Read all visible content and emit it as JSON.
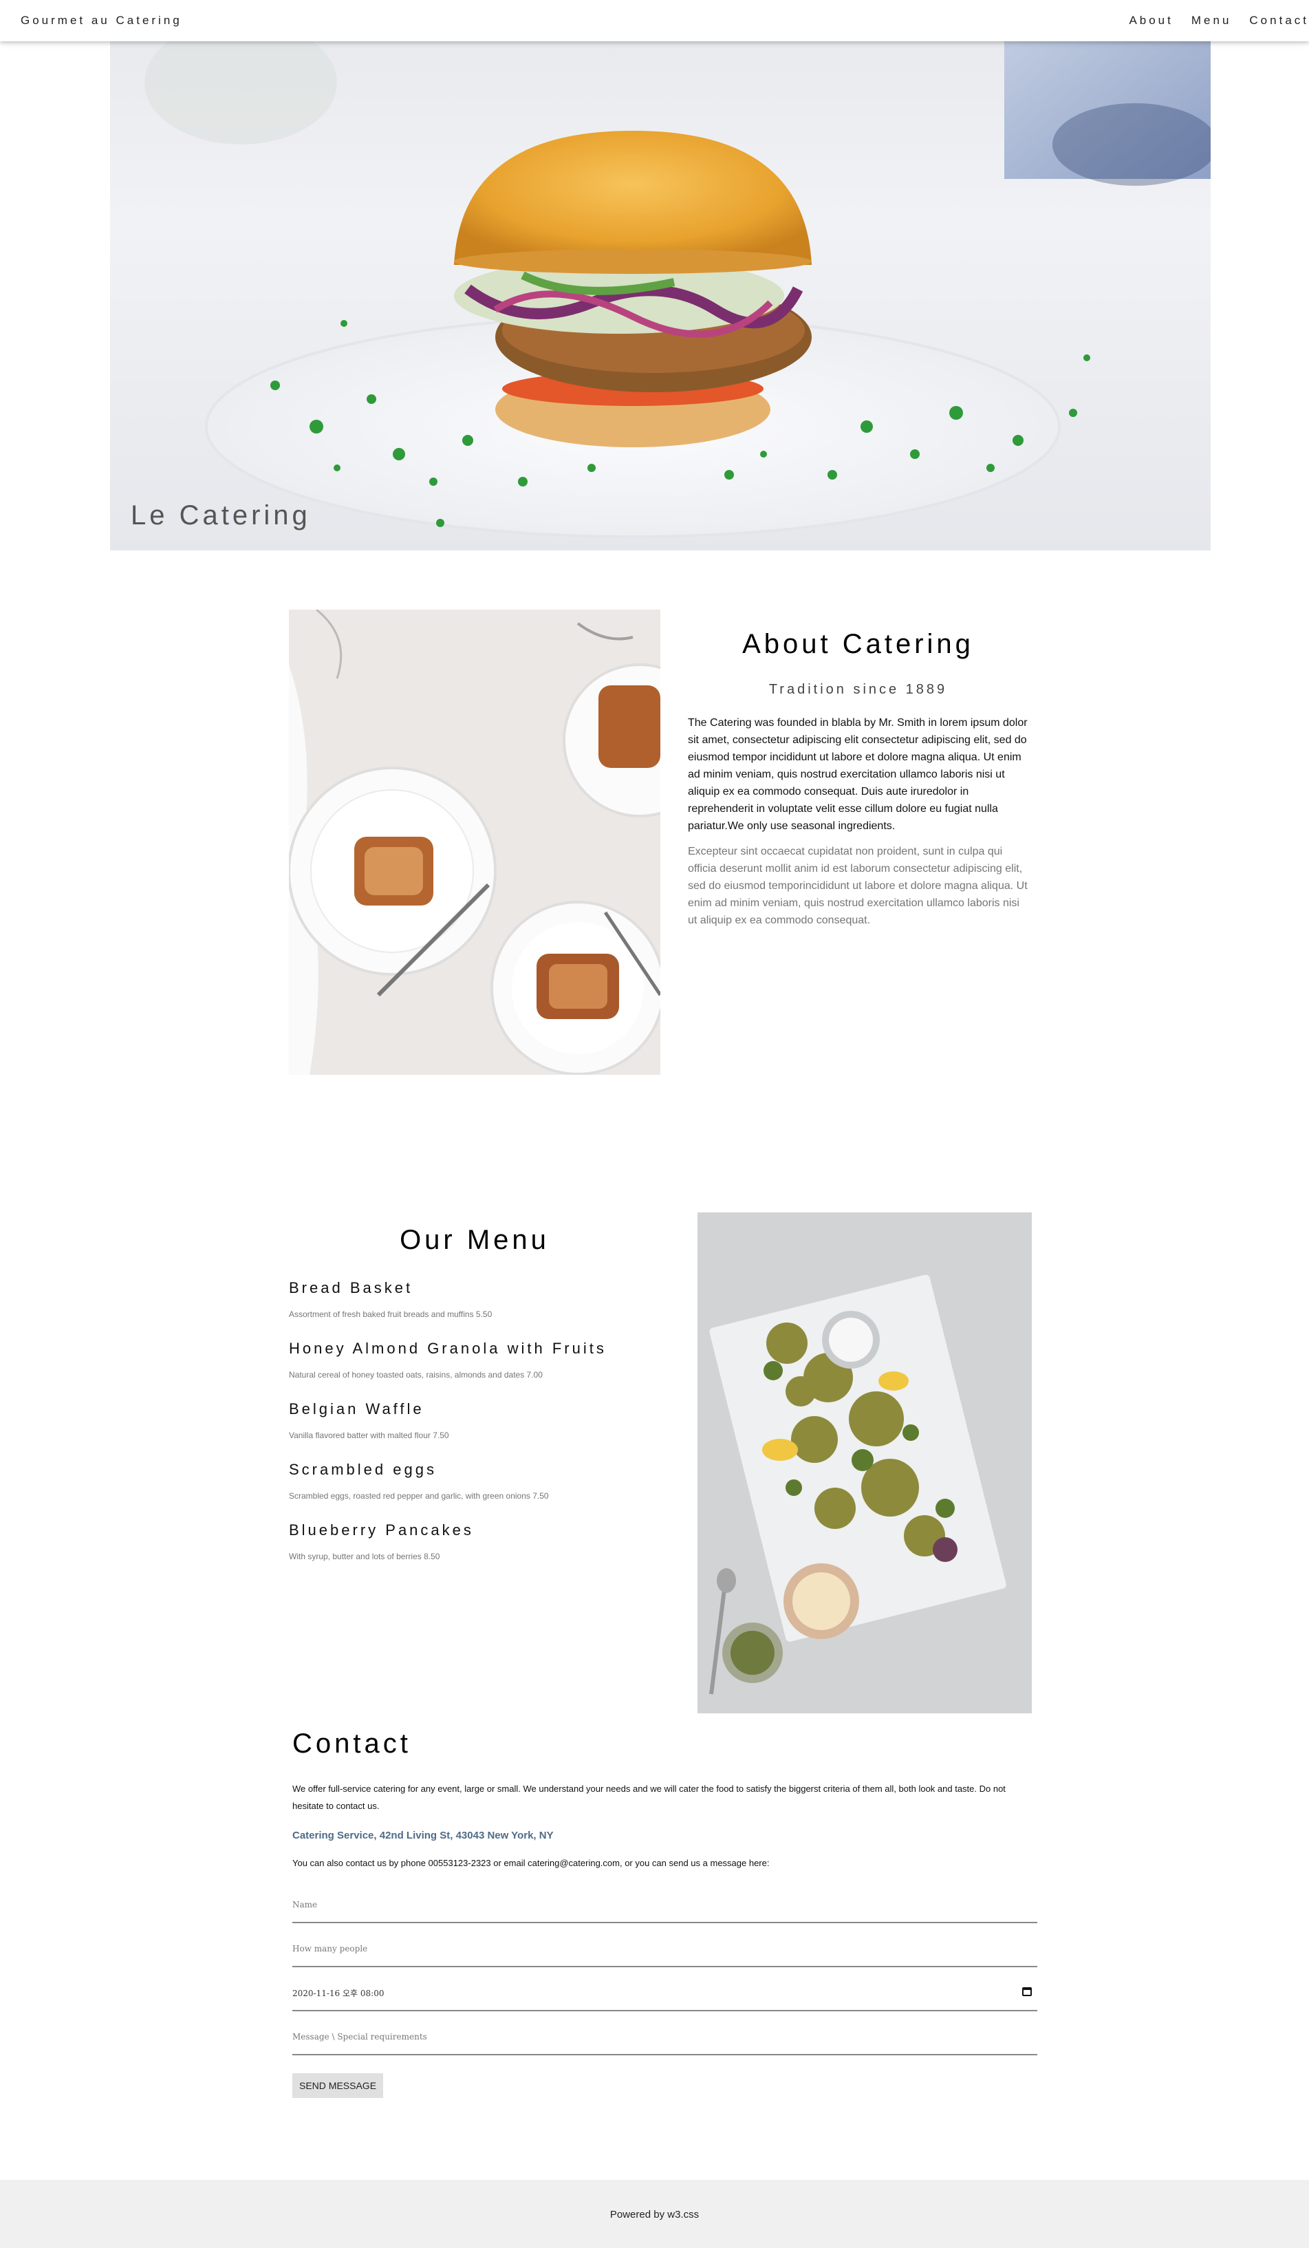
{
  "nav": {
    "brand": "Gourmet au Catering",
    "links": [
      "About",
      "Menu",
      "Contact"
    ]
  },
  "hero": {
    "caption": "Le Catering"
  },
  "about": {
    "title": "About Catering",
    "subtitle": "Tradition since 1889",
    "paragraph": "The Catering was founded in blabla by Mr. Smith in lorem ipsum dolor sit amet, consectetur adipiscing elit consectetur adipiscing elit, sed do eiusmod tempor incididunt ut labore et dolore magna aliqua. Ut enim ad minim veniam, quis nostrud exercitation ullamco laboris nisi ut aliquip ex ea commodo consequat. Duis aute iruredolor in reprehenderit in voluptate velit esse cillum dolore eu fugiat nulla pariatur.We only use seasonal ingredients.",
    "paragraph_secondary": "Excepteur sint occaecat cupidatat non proident, sunt in culpa qui officia deserunt mollit anim id est laborum consectetur adipiscing elit, sed do eiusmod temporincididunt ut labore et dolore magna aliqua. Ut enim ad minim veniam, quis nostrud exercitation ullamco laboris nisi ut aliquip ex ea commodo consequat."
  },
  "menu": {
    "title": "Our Menu",
    "items": [
      {
        "name": "Bread Basket",
        "description": "Assortment of fresh baked fruit breads and muffins 5.50"
      },
      {
        "name": "Honey Almond Granola with Fruits",
        "description": "Natural cereal of honey toasted oats, raisins, almonds and dates 7.00"
      },
      {
        "name": "Belgian Waffle",
        "description": "Vanilla flavored batter with malted flour 7.50"
      },
      {
        "name": "Scrambled eggs",
        "description": "Scrambled eggs, roasted red pepper and garlic, with green onions 7.50"
      },
      {
        "name": "Blueberry Pancakes",
        "description": "With syrup, butter and lots of berries 8.50"
      }
    ]
  },
  "contact": {
    "title": "Contact",
    "intro": "We offer full-service catering for any event, large or small. We understand your needs and we will cater the food to satisfy the biggerst criteria of them all, both look and taste. Do not hesitate to contact us.",
    "address": "Catering Service, 42nd Living St, 43043 New York, NY",
    "phone_text": "You can also contact us by phone 00553123-2323 or email catering@catering.com, or you can send us a message here:",
    "form": {
      "name_placeholder": "Name",
      "people_placeholder": "How many people",
      "datetime_value": "2020-11-16 오후 08:00",
      "message_placeholder": "Message \\ Special requirements",
      "send_label": "SEND MESSAGE"
    }
  },
  "footer": {
    "text": "Powered by w3.css"
  }
}
